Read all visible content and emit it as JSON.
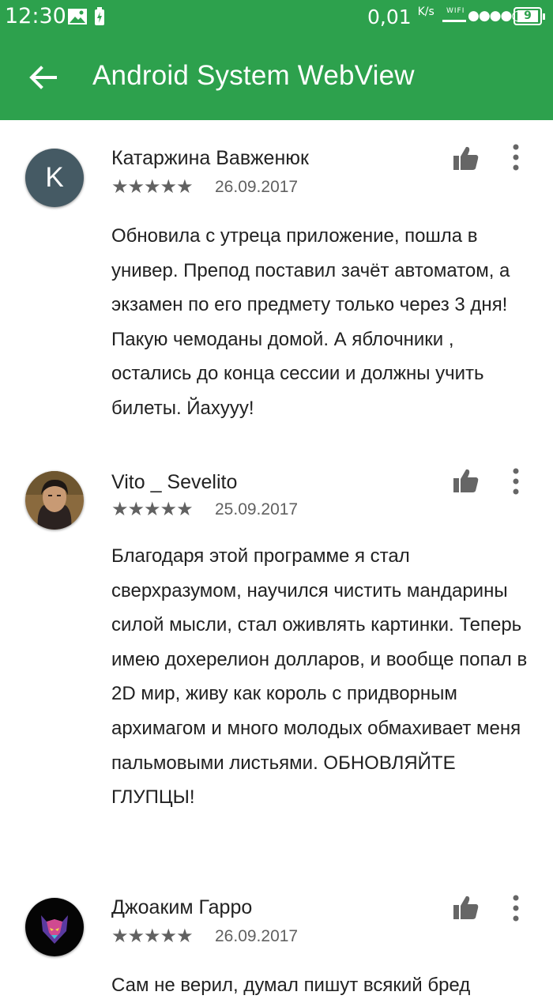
{
  "status_bar": {
    "time": "12:30",
    "net_speed": "0,01",
    "net_unit": "K/s",
    "wifi_label": "WIFI",
    "battery": "9"
  },
  "app_bar": {
    "title": "Android System WebView"
  },
  "reviews": [
    {
      "initial": "K",
      "author": "Катаржина Вавженюк",
      "stars": "★★★★★",
      "rating": 5,
      "date": "26.09.2017",
      "text": "Обновила с утреца приложение, пошла в универ. Препод поставил зачёт автоматом, а экзамен по его предмету только через 3 дня! Пакую чемоданы домой. А яблочники , остались до конца сессии и должны учить билеты. Йахууу!"
    },
    {
      "author": "Vito _ Sevelito",
      "stars": "★★★★★",
      "rating": 5,
      "date": "25.09.2017",
      "text": "Благодаря этой программе я стал сверхразумом, научился чистить мандарины силой мысли, стал оживлять картинки. Теперь имею дохерелион долларов, и вообще попал в 2D мир, живу как король с придворным архимагом и много молодых обмахивает меня пальмовыми листьями. ОБНОВЛЯЙТЕ ГЛУПЦЫ!"
    },
    {
      "author": "Джоаким Гарро",
      "stars": "★★★★★",
      "rating": 5,
      "date": "26.09.2017",
      "text": "Сам не верил, думал пишут всякий бред"
    }
  ]
}
